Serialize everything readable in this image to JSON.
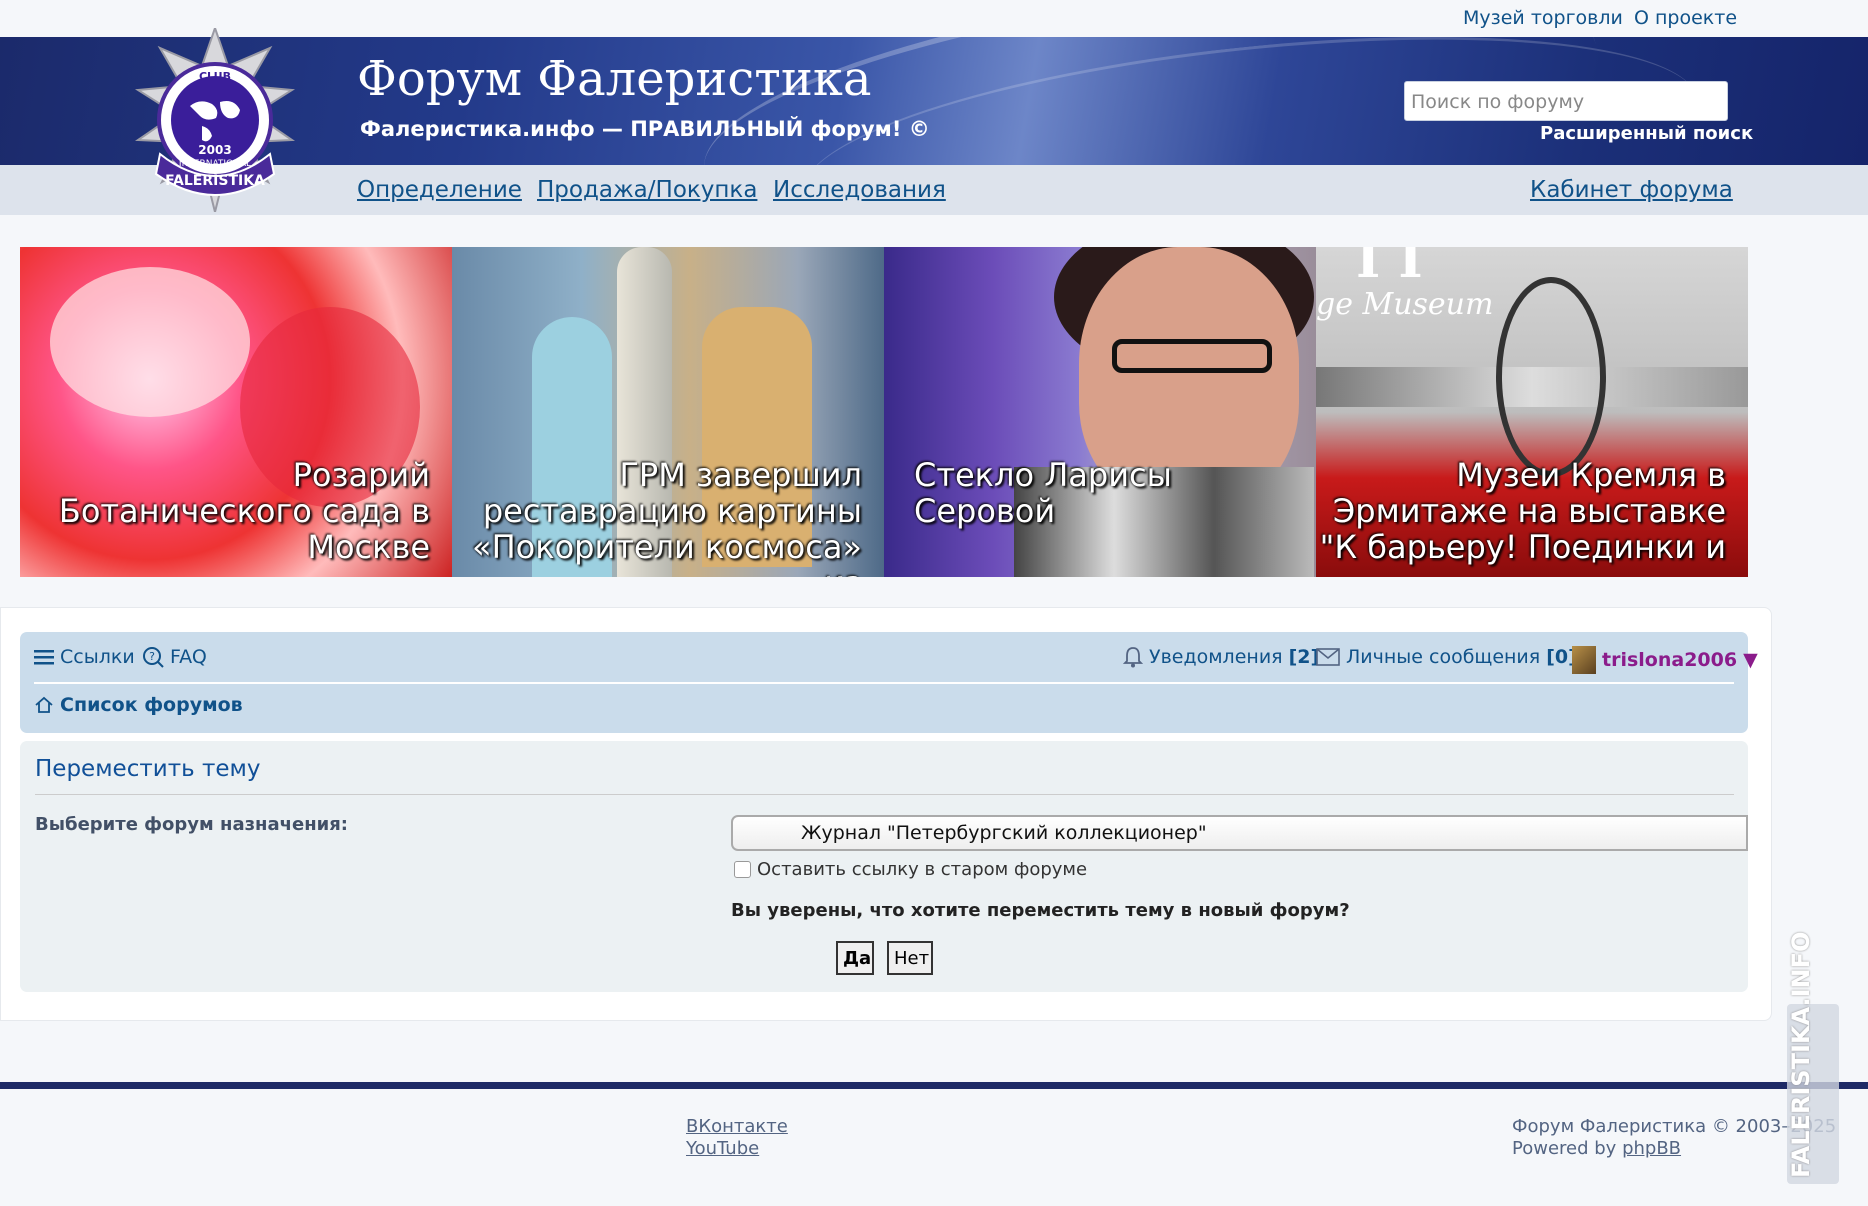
{
  "top_links": [
    "Музей торговли",
    "О проекте"
  ],
  "header": {
    "title": "Форум Фалеристика",
    "subtitle": "Фалеристика.инфо — ПРАВИЛЬНЫЙ форум! ©",
    "search_placeholder": "Поиск по форуму",
    "advanced_search": "Расширенный поиск",
    "logo_text": {
      "top": "CLUB",
      "middle": "INTERNATIONAL",
      "year": "2003",
      "bottom": "FALERISTIKA"
    }
  },
  "nav": {
    "items": [
      "Определение",
      "Продажа/Покупка",
      "Исследования"
    ],
    "cabinet": "Кабинет форума"
  },
  "banners": [
    {
      "caption": "Розарий Ботанического сада в Москве"
    },
    {
      "caption": "ГРМ завершил реставрацию картины «Покорители космоса» из"
    },
    {
      "caption": "Стекло Ларисы Серовой"
    },
    {
      "caption": "Музеи Кремля в Эрмитаже на выставке \"К барьеру! Поединки и",
      "image_text": "ge Museum"
    }
  ],
  "navbar": {
    "links_label": "Ссылки",
    "faq_label": "FAQ",
    "notifications_label": "Уведомления",
    "notifications_count": "[2]",
    "pm_label": "Личные сообщения",
    "pm_count": "[0]",
    "username": "trislona2006",
    "breadcrumb": "Список форумов"
  },
  "move_topic": {
    "title": "Переместить тему",
    "target_label": "Выберите форум назначения:",
    "target_value": "Журнал \"Петербургский коллекционер\"",
    "leave_link_label": "Оставить ссылку в старом форуме",
    "confirm_question": "Вы уверены, что хотите переместить тему в новый форум?",
    "yes_label": "Да",
    "no_label": "Нет"
  },
  "footer": {
    "links": [
      "ВКонтакте",
      "YouTube"
    ],
    "copyright": "Форум Фалеристика © 2003–2025",
    "powered_prefix": "Powered by",
    "powered_link": "phpBB",
    "watermark": "FALERISTIKA.INFO"
  },
  "colors": {
    "header_blue": "#1b2a6b",
    "link": "#105289",
    "navpanel_bg": "#cadceb",
    "panel_bg": "#ecf1f3",
    "username": "#8b1c8b",
    "footer_bar": "#1e2a66"
  }
}
